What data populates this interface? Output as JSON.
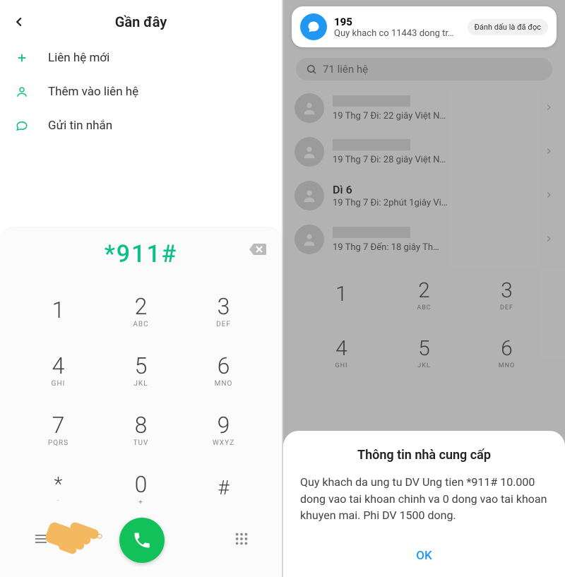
{
  "left": {
    "header": {
      "title": "Gần đây"
    },
    "menu": [
      {
        "label": "Liên hệ mới",
        "icon": "plus"
      },
      {
        "label": "Thêm vào liên hệ",
        "icon": "person"
      },
      {
        "label": "Gửi tin nhắn",
        "icon": "chat"
      }
    ],
    "dial_input": "*911#",
    "keypad": [
      {
        "n": "1",
        "l": " "
      },
      {
        "n": "2",
        "l": "ABC"
      },
      {
        "n": "3",
        "l": "DEF"
      },
      {
        "n": "4",
        "l": "GHI"
      },
      {
        "n": "5",
        "l": "JKL"
      },
      {
        "n": "6",
        "l": "MNO"
      },
      {
        "n": "7",
        "l": "PQRS"
      },
      {
        "n": "8",
        "l": "TUV"
      },
      {
        "n": "9",
        "l": "WXYZ"
      },
      {
        "n": "*",
        "l": "·"
      },
      {
        "n": "0",
        "l": "+"
      },
      {
        "n": "#",
        "l": ""
      }
    ]
  },
  "right": {
    "notification": {
      "title": "195",
      "text": "Quy khach co 11443 dong tr…",
      "button": "Đánh dấu là đã đọc"
    },
    "search": "71 liên hệ",
    "calls": [
      {
        "name": "",
        "sub": "19 Thg 7 Đi: 22 giây  Việt N…",
        "redacted": true
      },
      {
        "name": "",
        "sub": "19 Thg 7 Đi: 28 giây  Việt N…",
        "redacted": true
      },
      {
        "name": "Dì 6",
        "sub": "19 Thg 7 Đi: 2phút 1giây  Vi…",
        "redacted": false
      },
      {
        "name": "",
        "sub": "19 Thg 7 Đến: 18 giây  Th…",
        "redacted": true
      }
    ],
    "keypad_row1": [
      {
        "n": "1",
        "l": ""
      },
      {
        "n": "2",
        "l": "ABC"
      },
      {
        "n": "3",
        "l": "DEF"
      }
    ],
    "keypad_row2": [
      {
        "n": "4",
        "l": "GHI"
      },
      {
        "n": "5",
        "l": "JKL"
      },
      {
        "n": "6",
        "l": "MNO"
      }
    ],
    "dialog": {
      "title": "Thông tin nhà cung cấp",
      "message": "Quy khach da ung tu DV Ung tien *911# 10.000 dong vao tai khoan chinh va 0 dong vao tai khoan khuyen mai. Phi DV 1500 dong.",
      "ok": "OK"
    }
  }
}
